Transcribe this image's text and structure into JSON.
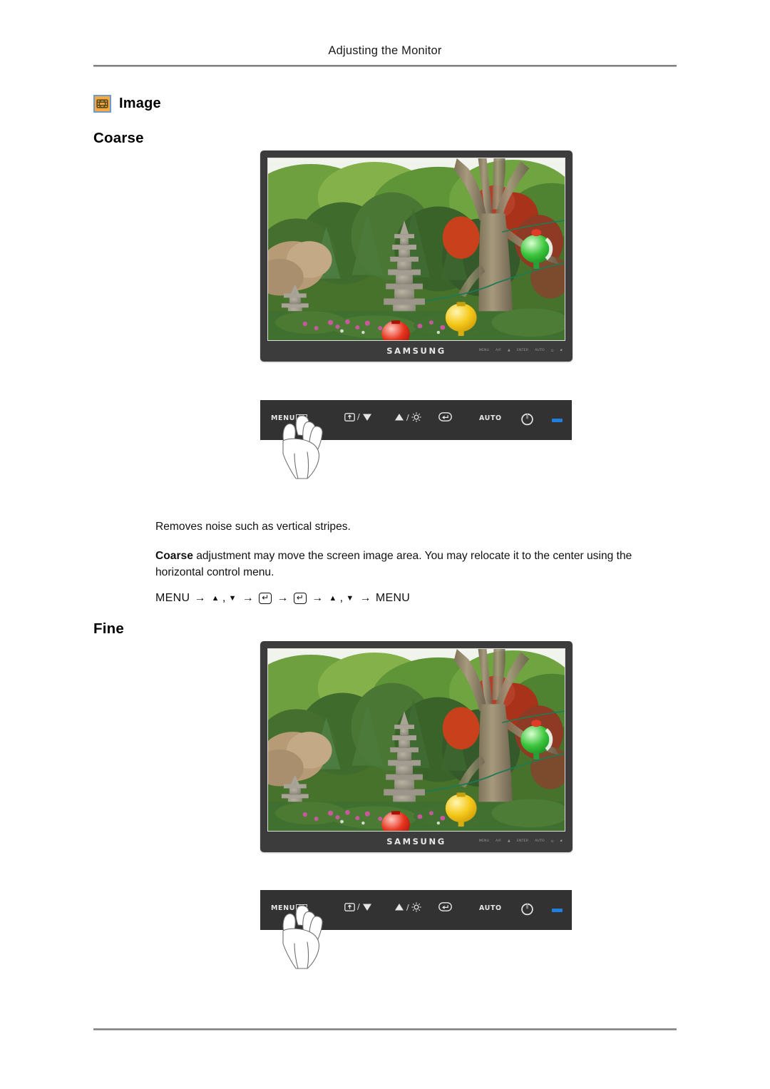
{
  "header": {
    "title": "Adjusting the Monitor"
  },
  "section": {
    "icon_name": "image-icon",
    "label": "Image",
    "icon_bg": "#f5a93f",
    "icon_border": "#6e9bd1"
  },
  "coarse": {
    "heading": "Coarse",
    "description_1": "Removes noise such as vertical stripes.",
    "description_2_bold": "Coarse",
    "description_2_rest": " adjustment may move the screen image area. You may relocate it to the center using the horizontal control menu.",
    "nav_path": {
      "start": "MENU",
      "up": "▲",
      "comma": ",",
      "down": "▼",
      "enter": "↵",
      "arrow": "→",
      "end": "MENU"
    }
  },
  "fine": {
    "heading": "Fine"
  },
  "monitor": {
    "brand": "SAMSUNG",
    "bezel_button_labels": [
      "MENU",
      "A/F",
      "▲",
      "ENTER",
      "AUTO",
      "⏻",
      "▪"
    ],
    "screen_alt": "Garden scene with stone pagodas, green trees, red and yellow lanterns"
  },
  "control_panel": {
    "menu_label": "MENU",
    "menu_icon": "menu-bars-icon",
    "source_icon": "source-input-icon",
    "down_arrow": "▼",
    "up_arrow": "▲",
    "brightness_icon": "brightness-sun-icon",
    "enter_icon": "enter-button-icon",
    "auto_label": "AUTO",
    "power_icon": "power-icon",
    "led_color": "#1f7fe0",
    "separator": "/"
  },
  "colors": {
    "bezel": "#3c3c3c",
    "panel": "#323232",
    "rule": "#808080",
    "text": "#111111"
  }
}
